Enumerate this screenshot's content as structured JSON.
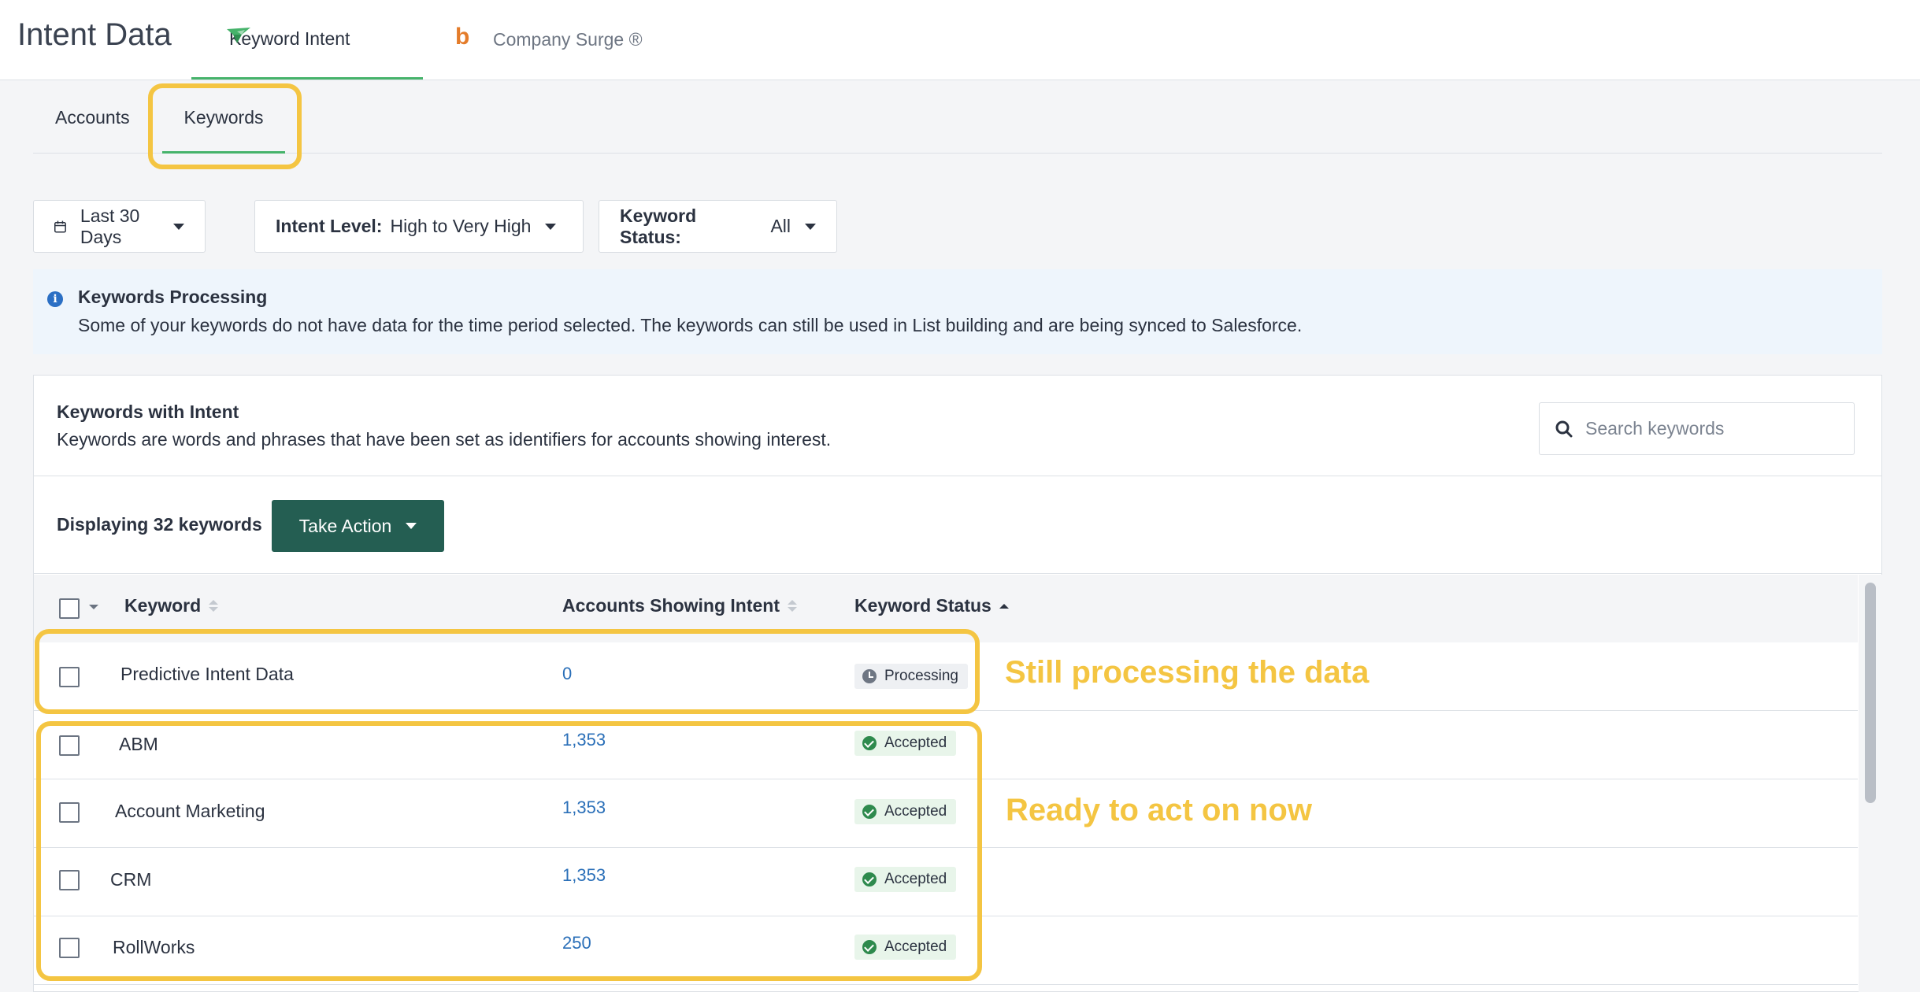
{
  "header": {
    "app_title": "Intent Data",
    "tabs": [
      {
        "label": "Keyword Intent",
        "active": true
      },
      {
        "label": "Company Surge ®",
        "active": false,
        "icon_letter": "b"
      }
    ]
  },
  "subtabs": [
    {
      "label": "Accounts",
      "active": false
    },
    {
      "label": "Keywords",
      "active": true
    }
  ],
  "filters": {
    "date": "Last 30 Days",
    "intent_level": {
      "label": "Intent Level:",
      "value": "High to Very High"
    },
    "keyword_status": {
      "label": "Keyword Status:",
      "value": "All"
    }
  },
  "banner": {
    "icon": "info-icon",
    "icon_glyph": "i",
    "title": "Keywords Processing",
    "text": "Some of your keywords do not have data for the time period selected. The keywords can still be used in List building and are being synced to Salesforce."
  },
  "card": {
    "title": "Keywords with Intent",
    "subtitle": "Keywords are words and phrases that have been set as identifiers for accounts showing interest.",
    "search_placeholder": "Search keywords",
    "displaying": "Displaying 32 keywords",
    "take_action": "Take Action"
  },
  "table": {
    "columns": [
      "Keyword",
      "Accounts Showing Intent",
      "Keyword Status"
    ],
    "rows": [
      {
        "keyword": "Predictive Intent Data",
        "accounts": "0",
        "status": "Processing"
      },
      {
        "keyword": "ABM",
        "accounts": "1,353",
        "status": "Accepted"
      },
      {
        "keyword": "Account Marketing",
        "accounts": "1,353",
        "status": "Accepted"
      },
      {
        "keyword": "CRM",
        "accounts": "1,353",
        "status": "Accepted"
      },
      {
        "keyword": "RollWorks",
        "accounts": "250",
        "status": "Accepted"
      }
    ]
  },
  "annotations": {
    "processing": "Still processing the data",
    "ready": "Ready to act on now",
    "color": "#f4c542"
  },
  "colors": {
    "accent_green": "#46b36b",
    "button_dark_green": "#245e52",
    "link_blue": "#2a6fb8",
    "info_blue": "#2b6fc4"
  }
}
